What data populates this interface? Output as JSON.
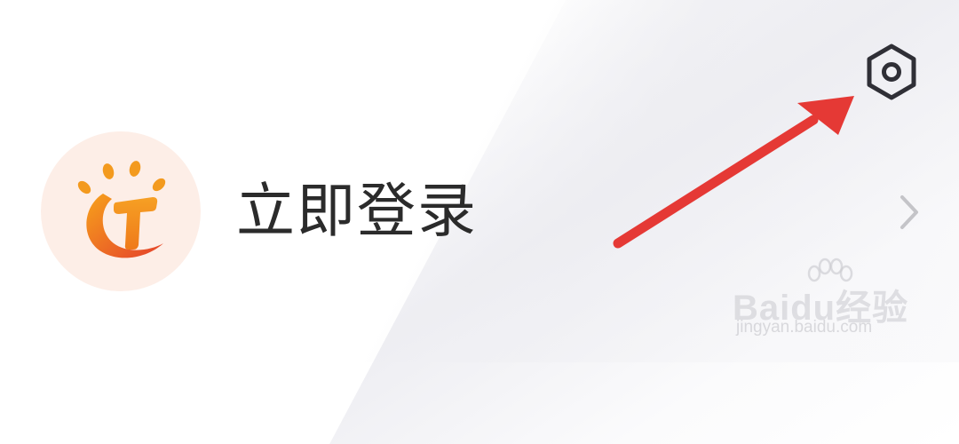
{
  "profile": {
    "login_label": "立即登录",
    "avatar_icon": "app-logo-icon"
  },
  "header": {
    "settings_icon": "settings-icon"
  },
  "row": {
    "chevron_icon": "chevron-right-icon"
  },
  "annotation": {
    "arrow_color": "#e53935"
  },
  "watermark": {
    "brand": "Baidu经验",
    "url": "jingyan.baidu.com"
  },
  "colors": {
    "text": "#2b2b2b",
    "avatar_bg": "#fdeee7",
    "logo_orange": "#f28a1c",
    "logo_red": "#e8452a"
  }
}
